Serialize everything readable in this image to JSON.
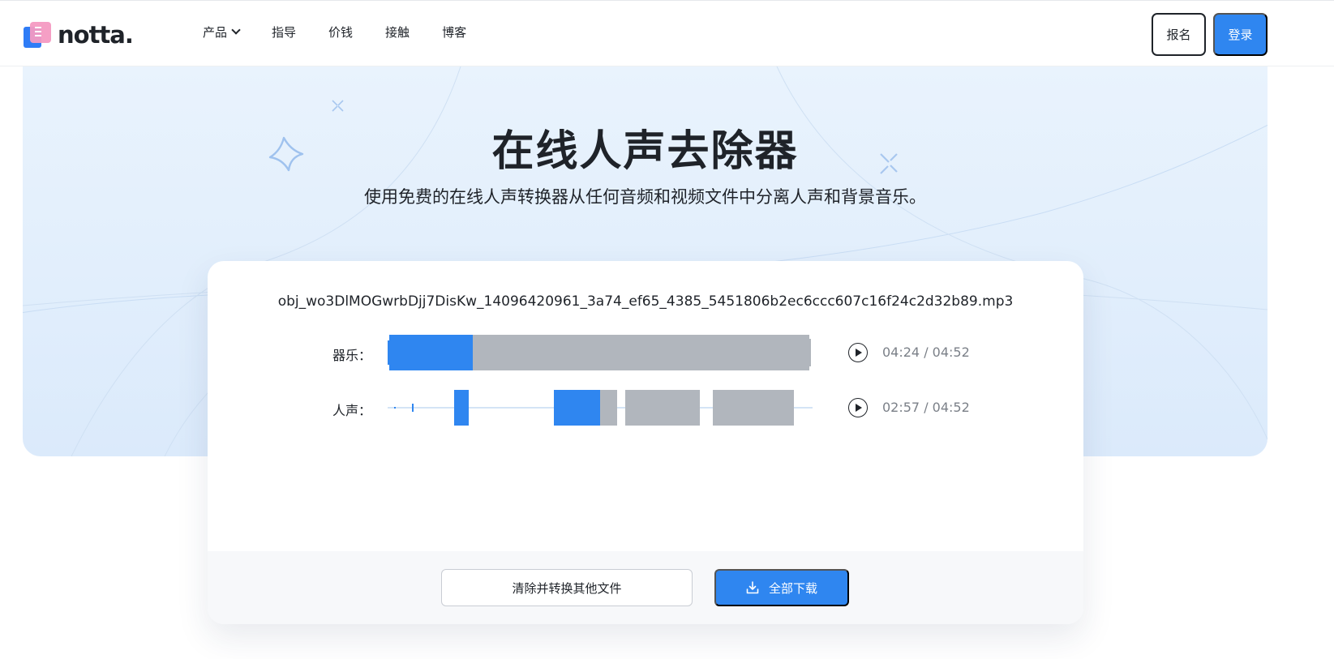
{
  "brand": {
    "name": "notta."
  },
  "nav": [
    {
      "label": "产品",
      "has_dropdown": true
    },
    {
      "label": "指导"
    },
    {
      "label": "价钱"
    },
    {
      "label": "接触"
    },
    {
      "label": "博客"
    }
  ],
  "header": {
    "signup_label": "报名",
    "login_label": "登录"
  },
  "hero": {
    "title": "在线人声去除器",
    "subtitle": "使用免费的在线人声转换器从任何音频和视频文件中分离人声和背景音乐。"
  },
  "result": {
    "filename": "obj_wo3DlMOGwrbDjj7DisKw_14096420961_3a74_ef65_4385_5451806b2ec6ccc607c16f24c2d32b89.mp3",
    "tracks": [
      {
        "label": "器乐：",
        "time": "04:24 / 04:52",
        "progress": 0.2,
        "played_color": "#2f86f0",
        "unplayed_color": "#b1b6bd"
      },
      {
        "label": "人声：",
        "time": "02:57 / 04:52",
        "progress": 0.5,
        "played_color": "#2f86f0",
        "unplayed_color": "#b1b6bd"
      }
    ],
    "clear_label": "清除并转换其他文件",
    "download_label": "全部下载"
  },
  "icons": {
    "play": "play-icon",
    "download": "download-icon",
    "chevron": "chevron-down-icon"
  },
  "colors": {
    "accent": "#2f86f0",
    "hero_bg": "#e3effc"
  }
}
